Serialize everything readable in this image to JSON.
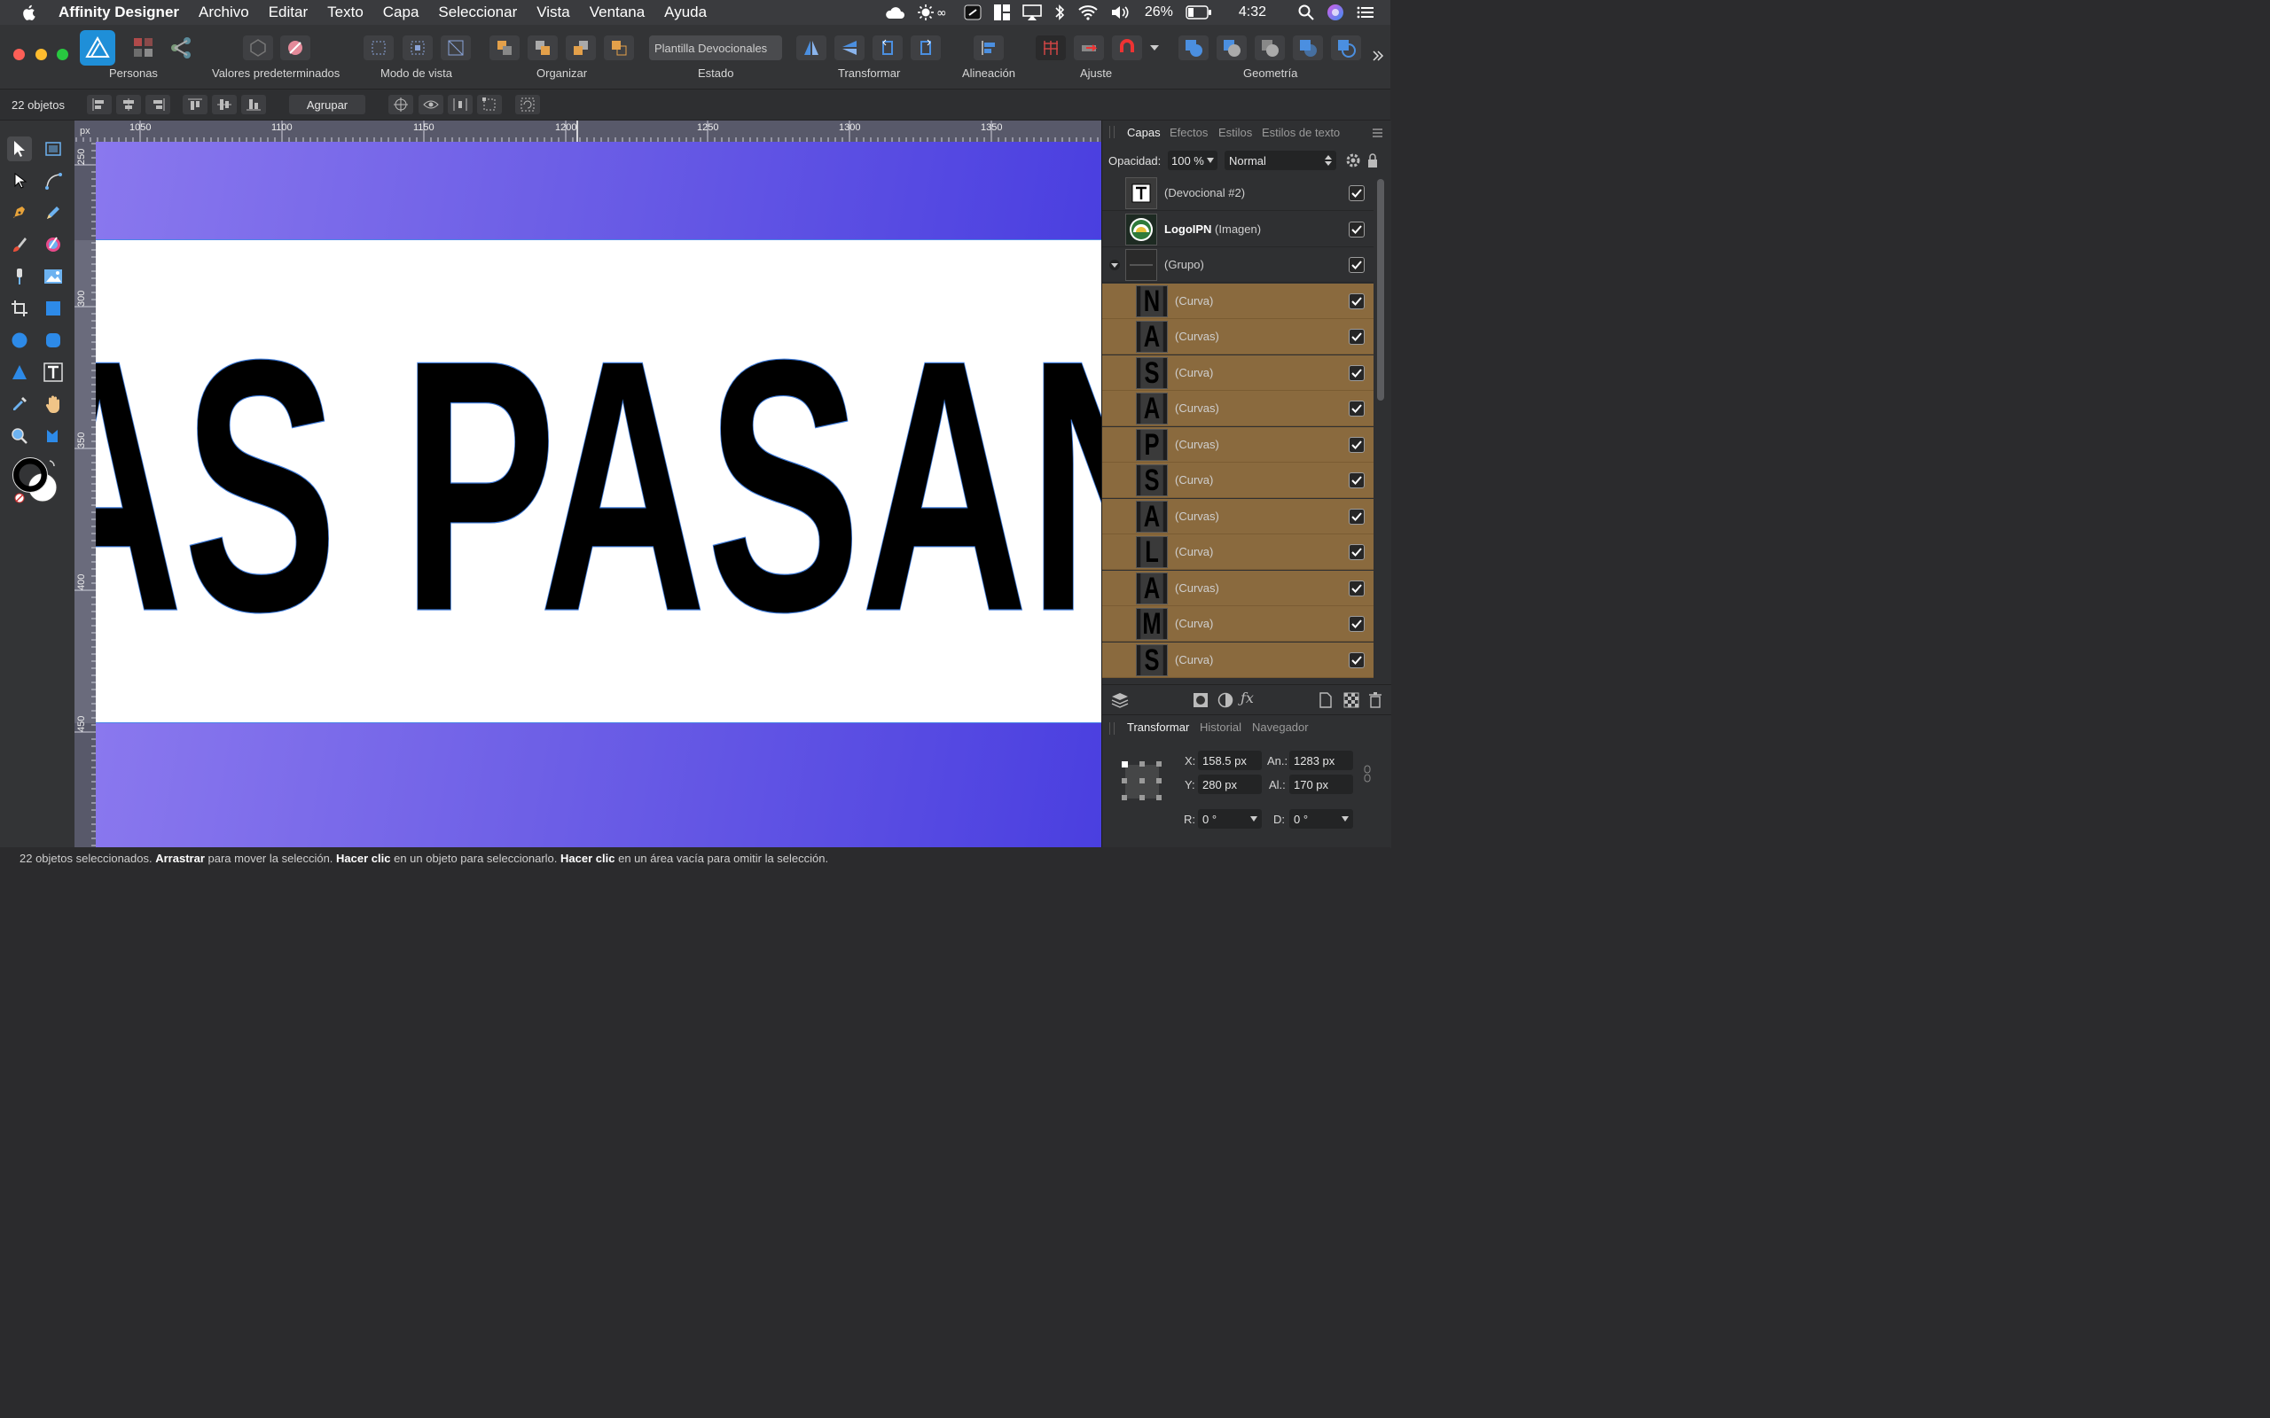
{
  "menubar": {
    "app_name": "Affinity Designer",
    "items": [
      "Archivo",
      "Editar",
      "Texto",
      "Capa",
      "Seleccionar",
      "Vista",
      "Ventana",
      "Ayuda"
    ],
    "battery": "26%",
    "clock": "4:32"
  },
  "toolbar": {
    "groups": {
      "personas": "Personas",
      "presets": "Valores predeterminados",
      "view_mode": "Modo de vista",
      "arrange": "Organizar",
      "state": "Estado",
      "transform": "Transformar",
      "align": "Alineación",
      "snap": "Ajuste",
      "geometry": "Geometría"
    },
    "state_value": "Plantilla Devocionales"
  },
  "context": {
    "object_count": "22 objetos",
    "group_button": "Agrupar"
  },
  "ruler": {
    "unit": "px",
    "top_labels": [
      "1050",
      "1100",
      "1150",
      "1200",
      "1250",
      "1300",
      "1350"
    ],
    "left_labels": [
      "250",
      "300",
      "350",
      "400",
      "450"
    ]
  },
  "canvas": {
    "text": "AS PASAN"
  },
  "layers_panel": {
    "tabs": [
      "Capas",
      "Efectos",
      "Estilos",
      "Estilos de texto"
    ],
    "opacity_label": "Opacidad:",
    "opacity_value": "100 %",
    "blend_mode": "Normal",
    "layers": [
      {
        "name": "(Devocional #2)",
        "bold": "",
        "thumb": "T"
      },
      {
        "name": " (Imagen)",
        "bold": "LogoIPN",
        "thumb": "logo"
      },
      {
        "name": "(Grupo)",
        "bold": "",
        "thumb": "group"
      },
      {
        "name": "(Curva)",
        "bold": "",
        "thumb": "N"
      },
      {
        "name": "(Curvas)",
        "bold": "",
        "thumb": "A"
      },
      {
        "name": "(Curva)",
        "bold": "",
        "thumb": "S"
      },
      {
        "name": "(Curvas)",
        "bold": "",
        "thumb": "A"
      },
      {
        "name": "(Curvas)",
        "bold": "",
        "thumb": "P"
      },
      {
        "name": "(Curva)",
        "bold": "",
        "thumb": "S"
      },
      {
        "name": "(Curvas)",
        "bold": "",
        "thumb": "A"
      },
      {
        "name": "(Curva)",
        "bold": "",
        "thumb": "L"
      },
      {
        "name": "(Curvas)",
        "bold": "",
        "thumb": "A"
      },
      {
        "name": "(Curva)",
        "bold": "",
        "thumb": "M"
      },
      {
        "name": "(Curva)",
        "bold": "",
        "thumb": "S"
      }
    ]
  },
  "transform_panel": {
    "tabs": [
      "Transformar",
      "Historial",
      "Navegador"
    ],
    "x_label": "X:",
    "x_value": "158.5 px",
    "y_label": "Y:",
    "y_value": "280 px",
    "w_label": "An.:",
    "w_value": "1283 px",
    "h_label": "Al.:",
    "h_value": "170 px",
    "r_label": "R:",
    "r_value": "0 °",
    "s_label": "D:",
    "s_value": "0 °"
  },
  "status": {
    "p1": "22 objetos seleccionados.",
    "b1": "Arrastrar",
    "p2": "para mover la selección.",
    "b2": "Hacer clic",
    "p3": "en un objeto para seleccionarlo.",
    "b3": "Hacer clic",
    "p4": "en un área vacía para omitir la selección."
  }
}
